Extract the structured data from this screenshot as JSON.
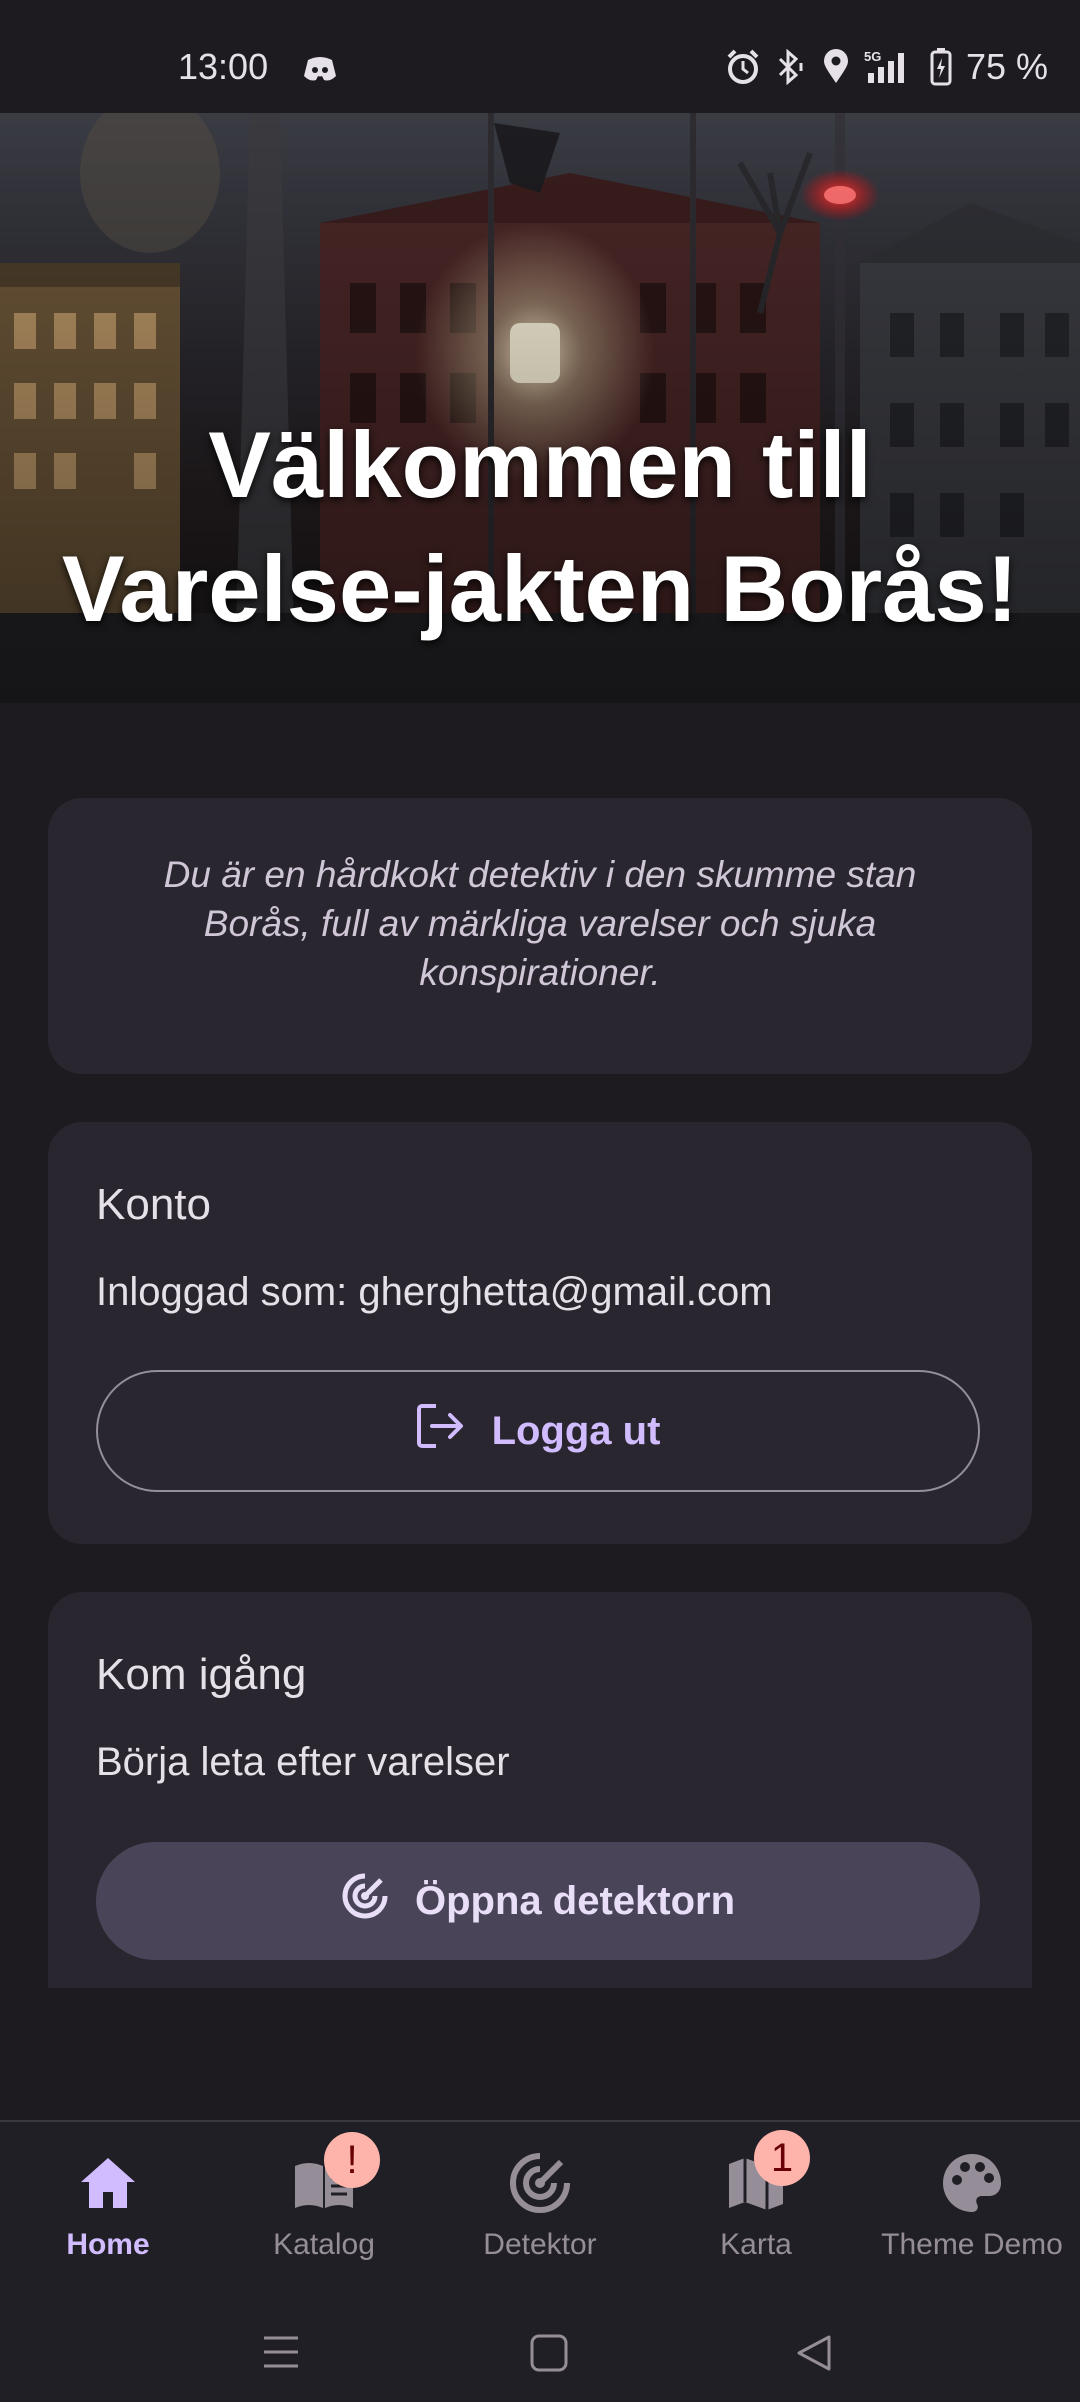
{
  "status_bar": {
    "time": "13:00",
    "battery": "75 %",
    "network": "5G"
  },
  "hero": {
    "title_line1": "Välkommen till",
    "title_line2": "Varelse-jakten Borås!"
  },
  "intro": {
    "text": "Du är en hårdkokt detektiv i den skumme stan Borås, full av märkliga varelser och sjuka konspirationer."
  },
  "account": {
    "title": "Konto",
    "logged_in_text": "Inloggad som: gherghetta@gmail.com",
    "logout_label": "Logga ut"
  },
  "get_started": {
    "title": "Kom igång",
    "text": "Börja leta efter varelser",
    "open_detector_label": "Öppna detektorn"
  },
  "nav": {
    "items": [
      {
        "label": "Home",
        "icon": "home-icon",
        "active": true
      },
      {
        "label": "Katalog",
        "icon": "book-icon",
        "badge": "!"
      },
      {
        "label": "Detektor",
        "icon": "radar-icon"
      },
      {
        "label": "Karta",
        "icon": "map-icon",
        "badge": "1"
      },
      {
        "label": "Theme Demo",
        "icon": "palette-icon"
      }
    ]
  },
  "colors": {
    "background": "#1d1b20",
    "card": "#2a2630",
    "accent": "#d0bcff",
    "badge": "#ffb4ab",
    "filled_button": "#4a4458"
  }
}
